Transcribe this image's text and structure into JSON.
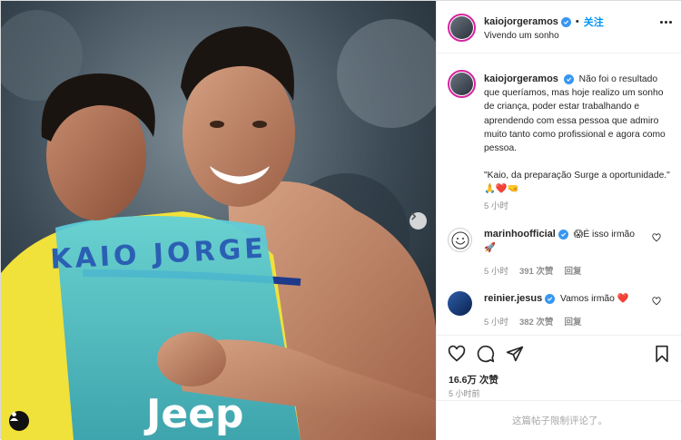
{
  "header": {
    "username": "kaiojorgeramos",
    "follow_label": "关注",
    "subtitle": "Vivendo um sonho",
    "separator": "•"
  },
  "caption": {
    "username": "kaiojorgeramos",
    "text": "Não foi o resultado que queríamos, mas hoje realizo um sonho de criança, poder estar trabalhando e aprendendo com essa pessoa que admiro muito tanto como profissional e agora como pessoa.",
    "quote": "\"Kaio, da preparação Surge a oportunidade.\" 🙏❤️🤜",
    "time": "5 小时"
  },
  "comments": [
    {
      "username": "marinhoofficial",
      "text": "😱É isso irmão 🚀",
      "time": "5 小时",
      "likes": "391 次赞",
      "reply": "回复"
    },
    {
      "username": "reinier.jesus",
      "text": "Vamos irmão ❤️",
      "time": "5 小时",
      "likes": "382 次赞",
      "reply": "回复"
    }
  ],
  "photo": {
    "jersey_name": "KAIO JORGE",
    "sponsor": "Jeep"
  },
  "actions": {
    "likes": "16.6万 次赞",
    "time": "5 小时前"
  },
  "limited_notice": "这篇帖子限制评论了。",
  "icons": {
    "next": "chevron-right-icon",
    "tagged_users": "user-tag-icon",
    "like": "heart-icon",
    "comment": "comment-icon",
    "share": "paper-plane-icon",
    "save": "bookmark-icon",
    "more": "more-options-icon",
    "verified": "verified-badge-icon"
  },
  "colors": {
    "accent": "#0095f6",
    "verified": "#3897f0",
    "heart": "#ed4956"
  }
}
